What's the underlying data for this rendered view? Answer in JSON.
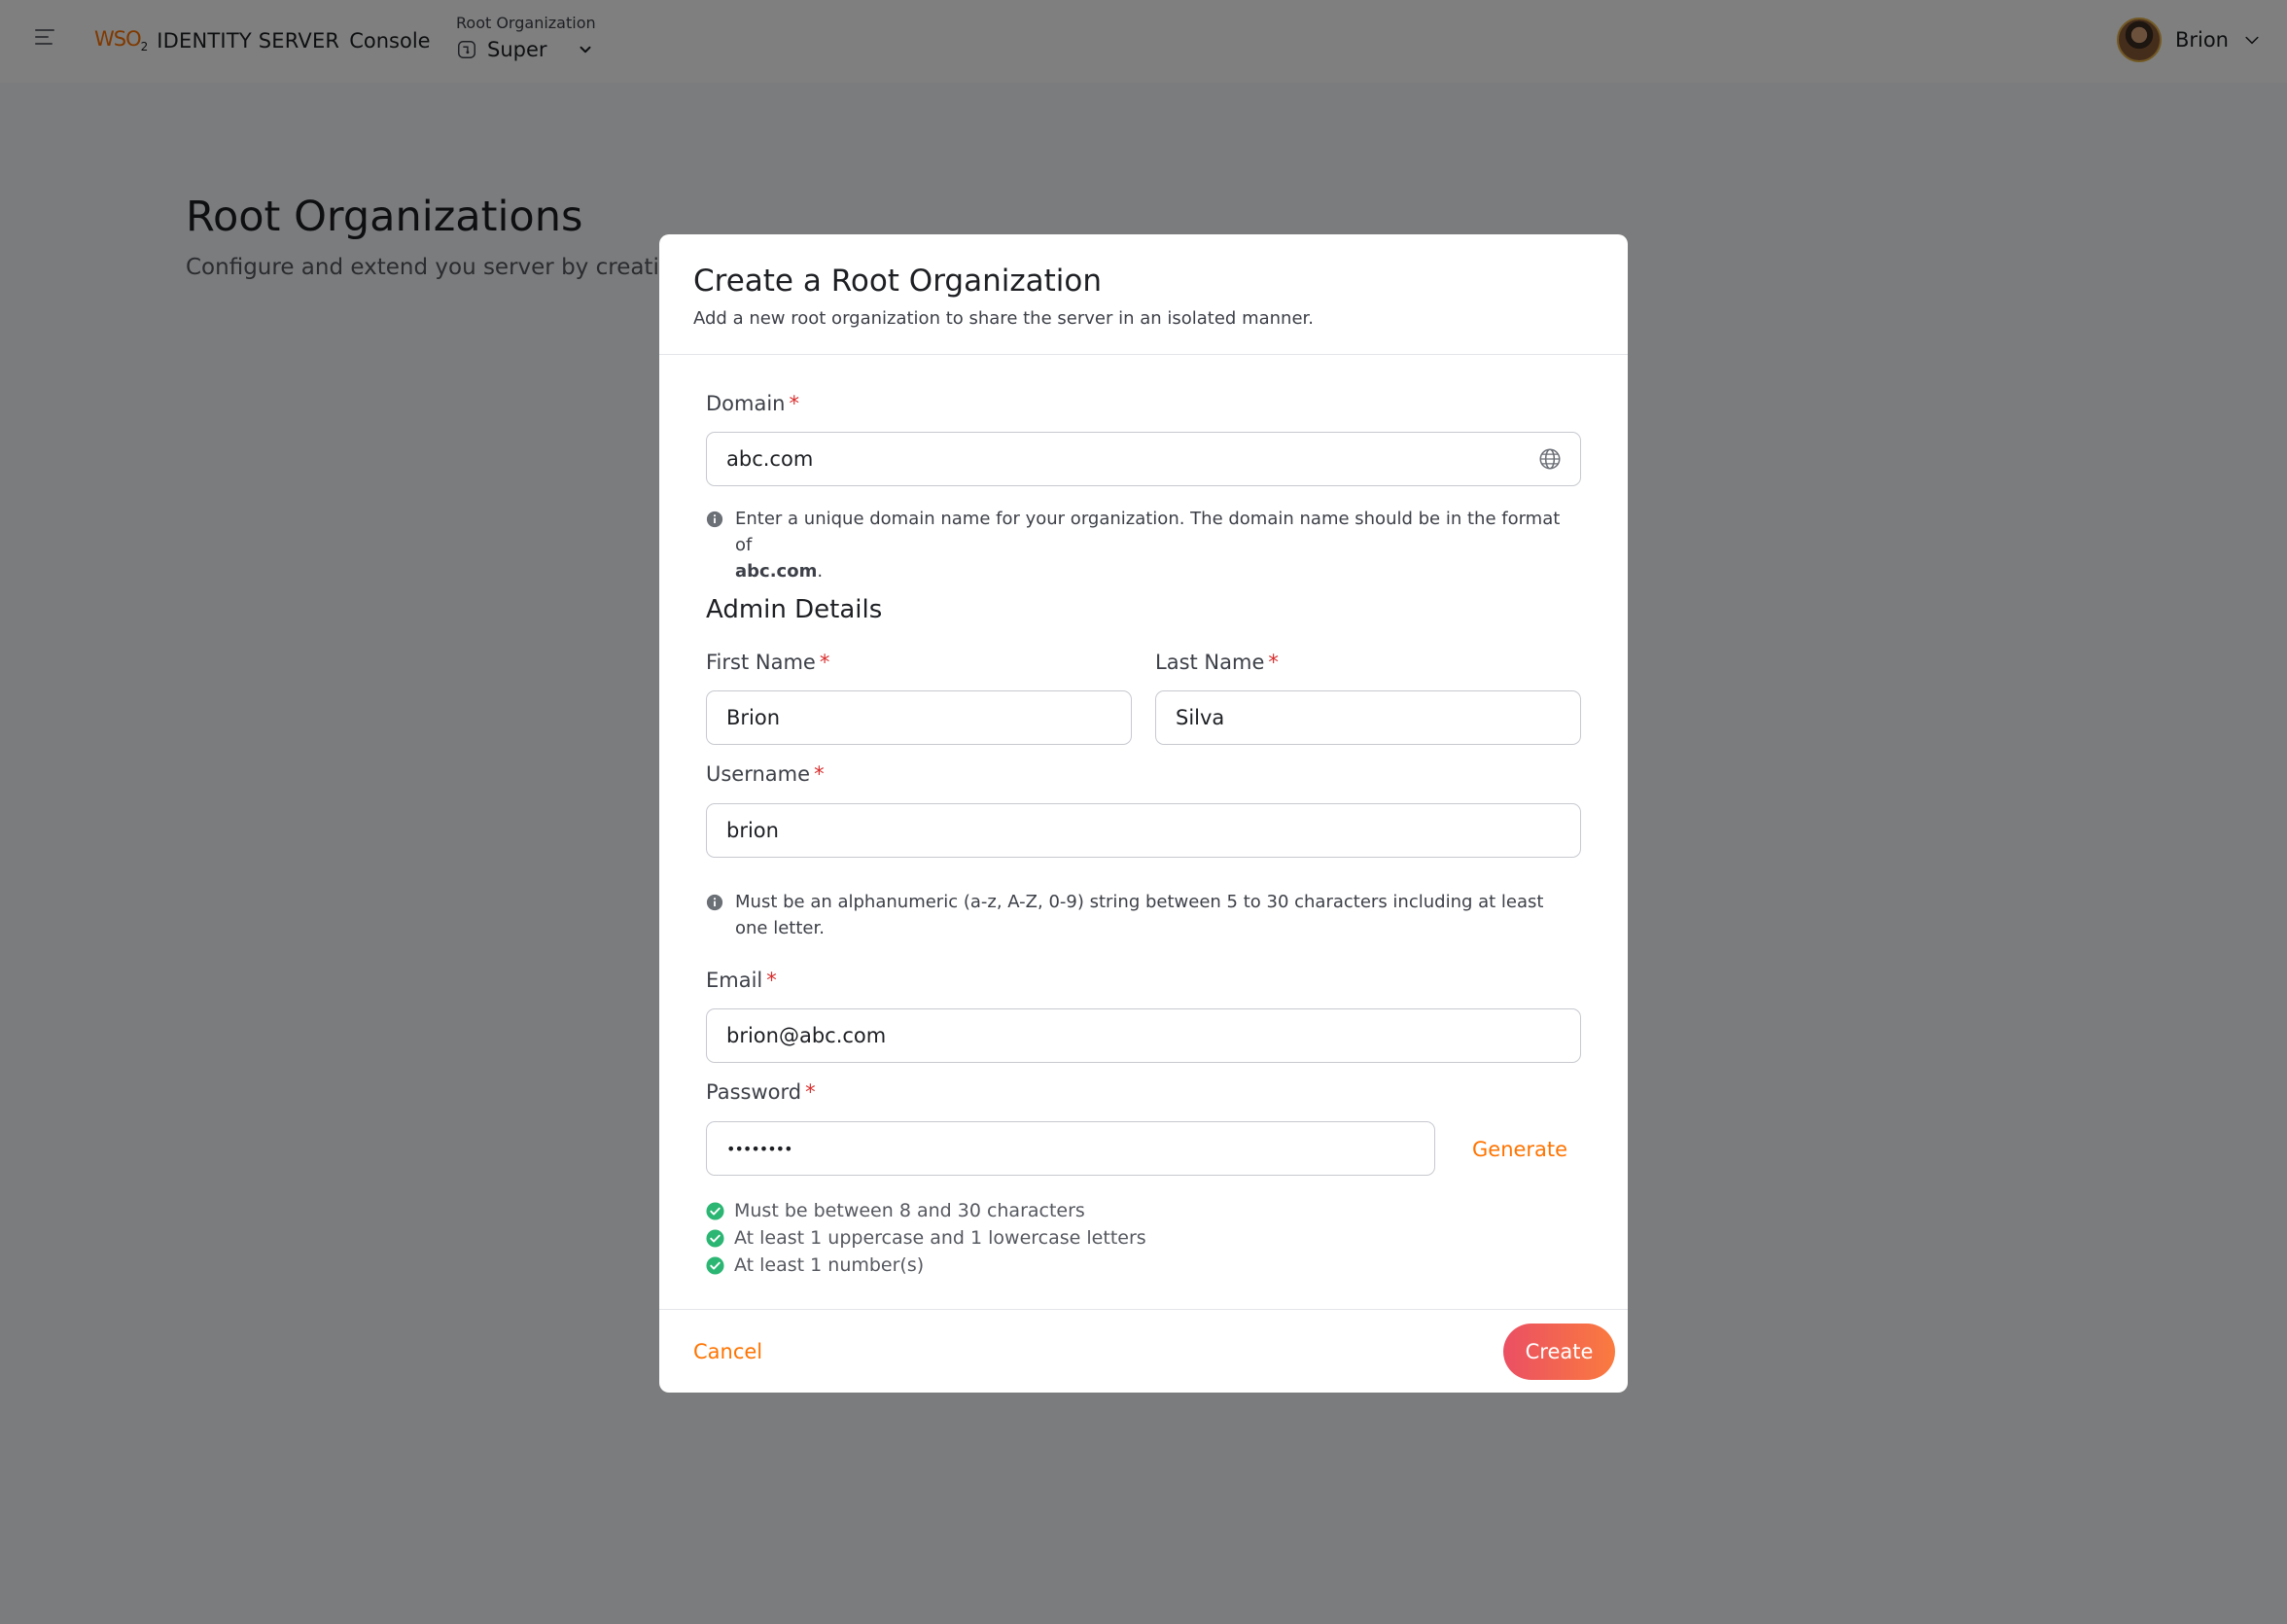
{
  "header": {
    "logo_text": "WSO2",
    "product": "IDENTITY SERVER",
    "app": "Console",
    "org_caption": "Root Organization",
    "org_name": "Super",
    "user_name": "Brion"
  },
  "page": {
    "title": "Root Organizations",
    "subtitle": "Configure and extend you server by creatin"
  },
  "modal": {
    "title": "Create a Root Organization",
    "description": "Add a new root organization to share the server in an isolated manner.",
    "domain": {
      "label": "Domain",
      "required": "*",
      "value": "abc.com",
      "hint_prefix": "Enter a unique domain name for your organization. The domain name should be in the format of",
      "hint_bold": "abc.com",
      "hint_suffix": "."
    },
    "admin_section": "Admin Details",
    "first_name": {
      "label": "First Name",
      "required": "*",
      "value": "Brion"
    },
    "last_name": {
      "label": "Last Name",
      "required": "*",
      "value": "Silva"
    },
    "username": {
      "label": "Username",
      "required": "*",
      "value": "brion",
      "hint": "Must be an alphanumeric (a-z, A-Z, 0-9) string between 5 to 30 characters including at least one letter."
    },
    "email": {
      "label": "Email",
      "required": "*",
      "value": "brion@abc.com"
    },
    "password": {
      "label": "Password",
      "required": "*",
      "value": "••••••••",
      "generate_label": "Generate"
    },
    "password_criteria": [
      "Must be between 8 and 30 characters",
      "At least 1 uppercase and 1 lowercase letters",
      "At least 1 number(s)"
    ],
    "cancel_label": "Cancel",
    "create_label": "Create"
  },
  "colors": {
    "accent": "#ff7300",
    "required": "#d92f2f",
    "success": "#2bb673",
    "button_gradient_start": "#eb4f63",
    "button_gradient_end": "#fa7b3f"
  }
}
